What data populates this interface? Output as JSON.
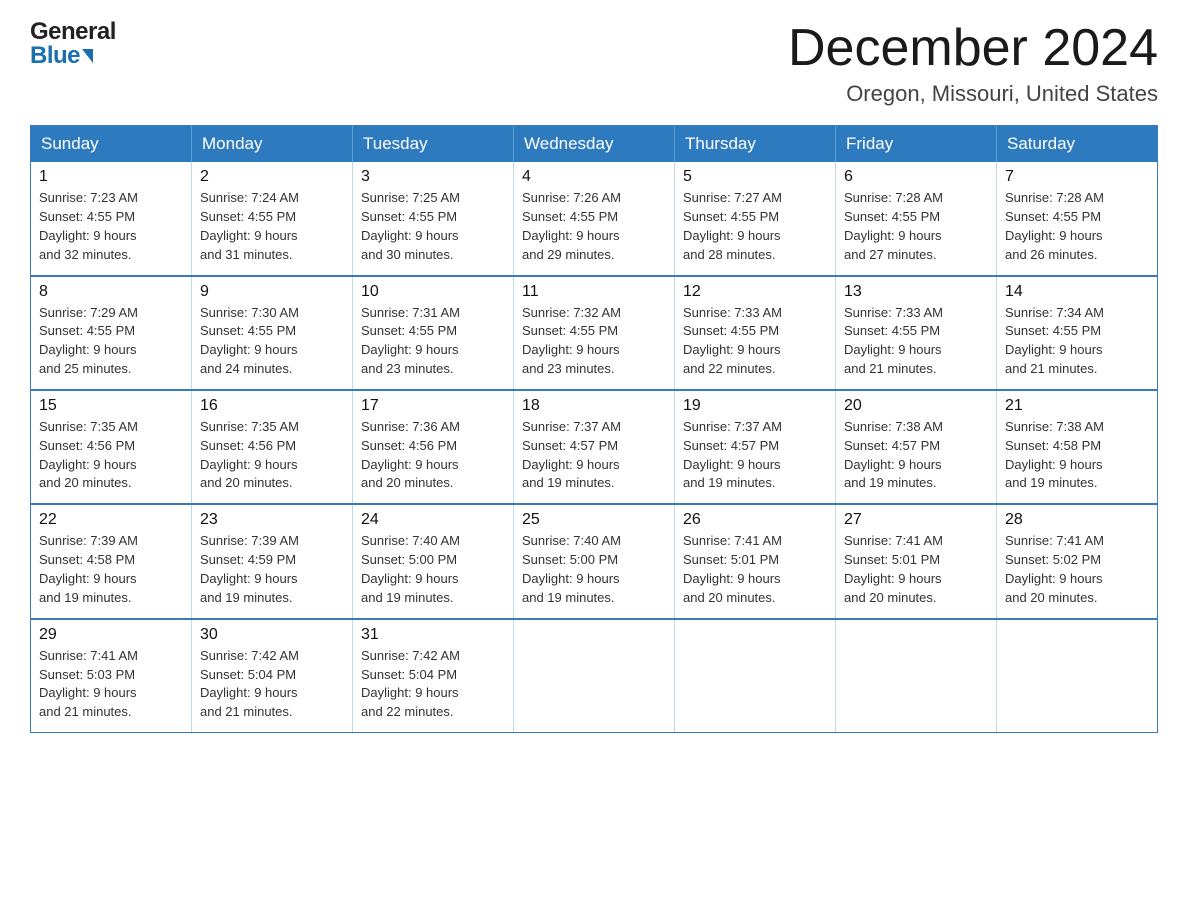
{
  "header": {
    "title": "December 2024",
    "subtitle": "Oregon, Missouri, United States",
    "logo_general": "General",
    "logo_blue": "Blue"
  },
  "weekdays": [
    "Sunday",
    "Monday",
    "Tuesday",
    "Wednesday",
    "Thursday",
    "Friday",
    "Saturday"
  ],
  "weeks": [
    [
      {
        "day": "1",
        "sunrise": "7:23 AM",
        "sunset": "4:55 PM",
        "daylight": "9 hours and 32 minutes."
      },
      {
        "day": "2",
        "sunrise": "7:24 AM",
        "sunset": "4:55 PM",
        "daylight": "9 hours and 31 minutes."
      },
      {
        "day": "3",
        "sunrise": "7:25 AM",
        "sunset": "4:55 PM",
        "daylight": "9 hours and 30 minutes."
      },
      {
        "day": "4",
        "sunrise": "7:26 AM",
        "sunset": "4:55 PM",
        "daylight": "9 hours and 29 minutes."
      },
      {
        "day": "5",
        "sunrise": "7:27 AM",
        "sunset": "4:55 PM",
        "daylight": "9 hours and 28 minutes."
      },
      {
        "day": "6",
        "sunrise": "7:28 AM",
        "sunset": "4:55 PM",
        "daylight": "9 hours and 27 minutes."
      },
      {
        "day": "7",
        "sunrise": "7:28 AM",
        "sunset": "4:55 PM",
        "daylight": "9 hours and 26 minutes."
      }
    ],
    [
      {
        "day": "8",
        "sunrise": "7:29 AM",
        "sunset": "4:55 PM",
        "daylight": "9 hours and 25 minutes."
      },
      {
        "day": "9",
        "sunrise": "7:30 AM",
        "sunset": "4:55 PM",
        "daylight": "9 hours and 24 minutes."
      },
      {
        "day": "10",
        "sunrise": "7:31 AM",
        "sunset": "4:55 PM",
        "daylight": "9 hours and 23 minutes."
      },
      {
        "day": "11",
        "sunrise": "7:32 AM",
        "sunset": "4:55 PM",
        "daylight": "9 hours and 23 minutes."
      },
      {
        "day": "12",
        "sunrise": "7:33 AM",
        "sunset": "4:55 PM",
        "daylight": "9 hours and 22 minutes."
      },
      {
        "day": "13",
        "sunrise": "7:33 AM",
        "sunset": "4:55 PM",
        "daylight": "9 hours and 21 minutes."
      },
      {
        "day": "14",
        "sunrise": "7:34 AM",
        "sunset": "4:55 PM",
        "daylight": "9 hours and 21 minutes."
      }
    ],
    [
      {
        "day": "15",
        "sunrise": "7:35 AM",
        "sunset": "4:56 PM",
        "daylight": "9 hours and 20 minutes."
      },
      {
        "day": "16",
        "sunrise": "7:35 AM",
        "sunset": "4:56 PM",
        "daylight": "9 hours and 20 minutes."
      },
      {
        "day": "17",
        "sunrise": "7:36 AM",
        "sunset": "4:56 PM",
        "daylight": "9 hours and 20 minutes."
      },
      {
        "day": "18",
        "sunrise": "7:37 AM",
        "sunset": "4:57 PM",
        "daylight": "9 hours and 19 minutes."
      },
      {
        "day": "19",
        "sunrise": "7:37 AM",
        "sunset": "4:57 PM",
        "daylight": "9 hours and 19 minutes."
      },
      {
        "day": "20",
        "sunrise": "7:38 AM",
        "sunset": "4:57 PM",
        "daylight": "9 hours and 19 minutes."
      },
      {
        "day": "21",
        "sunrise": "7:38 AM",
        "sunset": "4:58 PM",
        "daylight": "9 hours and 19 minutes."
      }
    ],
    [
      {
        "day": "22",
        "sunrise": "7:39 AM",
        "sunset": "4:58 PM",
        "daylight": "9 hours and 19 minutes."
      },
      {
        "day": "23",
        "sunrise": "7:39 AM",
        "sunset": "4:59 PM",
        "daylight": "9 hours and 19 minutes."
      },
      {
        "day": "24",
        "sunrise": "7:40 AM",
        "sunset": "5:00 PM",
        "daylight": "9 hours and 19 minutes."
      },
      {
        "day": "25",
        "sunrise": "7:40 AM",
        "sunset": "5:00 PM",
        "daylight": "9 hours and 19 minutes."
      },
      {
        "day": "26",
        "sunrise": "7:41 AM",
        "sunset": "5:01 PM",
        "daylight": "9 hours and 20 minutes."
      },
      {
        "day": "27",
        "sunrise": "7:41 AM",
        "sunset": "5:01 PM",
        "daylight": "9 hours and 20 minutes."
      },
      {
        "day": "28",
        "sunrise": "7:41 AM",
        "sunset": "5:02 PM",
        "daylight": "9 hours and 20 minutes."
      }
    ],
    [
      {
        "day": "29",
        "sunrise": "7:41 AM",
        "sunset": "5:03 PM",
        "daylight": "9 hours and 21 minutes."
      },
      {
        "day": "30",
        "sunrise": "7:42 AM",
        "sunset": "5:04 PM",
        "daylight": "9 hours and 21 minutes."
      },
      {
        "day": "31",
        "sunrise": "7:42 AM",
        "sunset": "5:04 PM",
        "daylight": "9 hours and 22 minutes."
      },
      null,
      null,
      null,
      null
    ]
  ],
  "labels": {
    "sunrise": "Sunrise:",
    "sunset": "Sunset:",
    "daylight": "Daylight:"
  }
}
